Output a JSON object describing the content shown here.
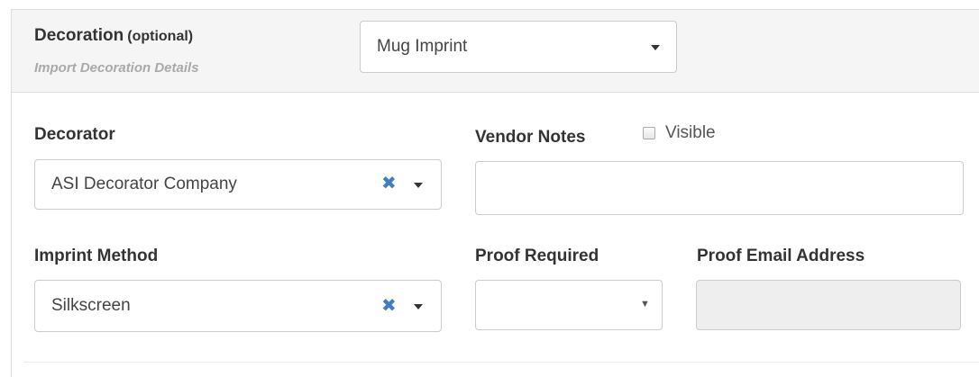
{
  "header": {
    "title": "Decoration",
    "title_suffix": "(optional)",
    "subtitle": "Import Decoration Details",
    "decoration_select": {
      "value": "Mug Imprint",
      "icon": "caret-down-icon"
    }
  },
  "decorator": {
    "label": "Decorator",
    "value": "ASI Decorator Company",
    "clear_icon": "close-icon",
    "caret_icon": "caret-down-icon"
  },
  "vendor_notes": {
    "label": "Vendor Notes",
    "visible_label": "Visible",
    "visible_checked": false,
    "value": ""
  },
  "imprint_method": {
    "label": "Imprint Method",
    "value": "Silkscreen",
    "clear_icon": "close-icon",
    "caret_icon": "caret-down-icon"
  },
  "proof_required": {
    "label": "Proof Required",
    "value": "",
    "caret_glyph": "▼"
  },
  "proof_email": {
    "label": "Proof Email Address",
    "value": "",
    "disabled": true
  },
  "colors": {
    "header_bg": "#f5f5f5",
    "border": "#cccccc",
    "clear_icon": "#3f7fbf",
    "subtitle": "#a9a9a9",
    "disabled_bg": "#eeeeee"
  }
}
